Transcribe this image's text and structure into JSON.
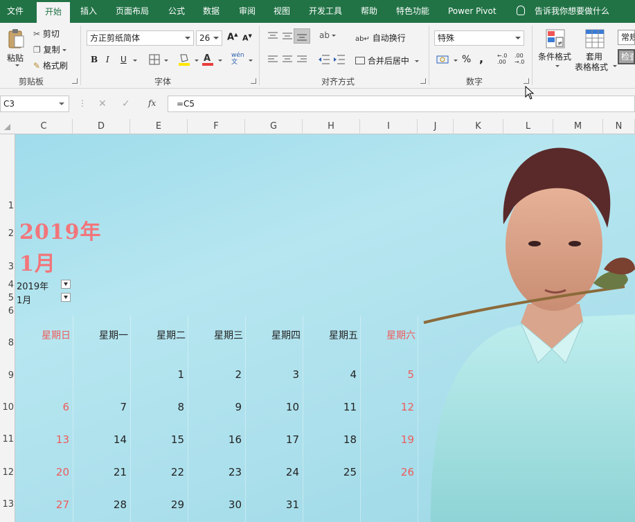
{
  "ribbon_tabs": [
    "文件",
    "开始",
    "插入",
    "页面布局",
    "公式",
    "数据",
    "审阅",
    "视图",
    "开发工具",
    "帮助",
    "特色功能",
    "Power Pivot"
  ],
  "active_tab": "开始",
  "tell_me": "告诉我你想要做什么",
  "clipboard": {
    "paste": "粘贴",
    "cut": "剪切",
    "copy": "复制",
    "format_painter": "格式刷",
    "label": "剪贴板"
  },
  "font": {
    "name": "方正剪纸简体",
    "size": "26",
    "bold": "B",
    "italic": "I",
    "underline": "U",
    "label": "字体"
  },
  "alignment": {
    "wrap": "自动换行",
    "merge": "合并后居中",
    "label": "对齐方式"
  },
  "number": {
    "format": "特殊",
    "percent": "%",
    "comma": ",",
    "label": "数字"
  },
  "styles": {
    "conditional": "条件格式",
    "table_format_1": "套用",
    "table_format_2": "表格格式",
    "cell_style_1": "常规",
    "cell_style_2": "检查"
  },
  "formula_bar": {
    "name_box": "C3",
    "formula": "=C5",
    "fx": "fx"
  },
  "columns": [
    "C",
    "D",
    "E",
    "F",
    "G",
    "H",
    "I",
    "J",
    "K",
    "L",
    "M",
    "N"
  ],
  "rows": [
    "1",
    "2",
    "3",
    "4",
    "5",
    "6",
    "8",
    "9",
    "10",
    "11",
    "12",
    "13"
  ],
  "calendar": {
    "year_title": "2019年",
    "month_title": "1月",
    "slicer_year": "2019年",
    "slicer_month": "1月",
    "weekdays": [
      "星期日",
      "星期一",
      "星期二",
      "星期三",
      "星期四",
      "星期五",
      "星期六"
    ],
    "weeks": [
      [
        "",
        "",
        "1",
        "2",
        "3",
        "4",
        "5"
      ],
      [
        "6",
        "7",
        "8",
        "9",
        "10",
        "11",
        "12"
      ],
      [
        "13",
        "14",
        "15",
        "16",
        "17",
        "18",
        "19"
      ],
      [
        "20",
        "21",
        "22",
        "23",
        "24",
        "25",
        "26"
      ],
      [
        "27",
        "28",
        "29",
        "30",
        "31",
        "",
        ""
      ]
    ],
    "weekend_color": "#ee5a5a",
    "title_color": "#f2757a"
  },
  "background_image": "person-with-rose-photo"
}
